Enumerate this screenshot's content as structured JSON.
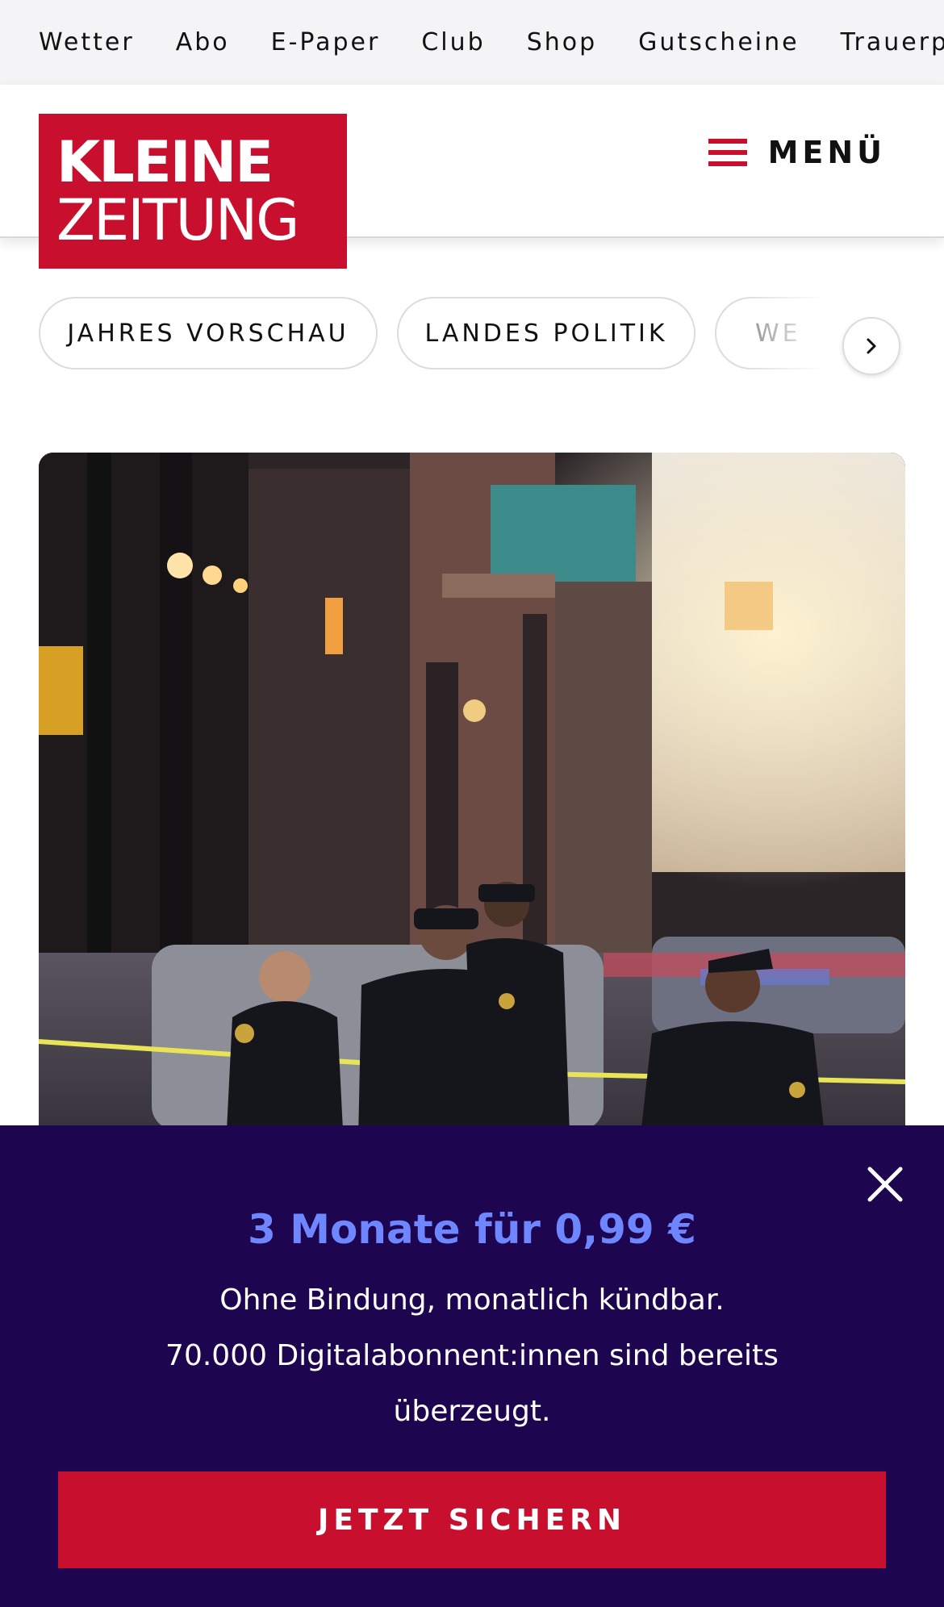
{
  "topnav": {
    "items": [
      "Wetter",
      "Abo",
      "E-Paper",
      "Club",
      "Shop",
      "Gutscheine",
      "Trauerportal"
    ]
  },
  "header": {
    "logo_line1": "KLEINE",
    "logo_line2": "ZEITUNG",
    "menu_label": "MENÜ",
    "brand_color": "#c8102e"
  },
  "categories": {
    "items": [
      "JAHRES VORSCHAU",
      "LANDES POLITIK",
      "WE"
    ]
  },
  "promo": {
    "title": "3 Monate für 0,99 €",
    "line1": "Ohne Bindung, monatlich kündbar.",
    "line2": "70.000 Digitalabonnent:innen sind bereits überzeugt.",
    "button": "JETZT SICHERN",
    "background": "#1d0550",
    "title_color": "#6e86ff"
  }
}
